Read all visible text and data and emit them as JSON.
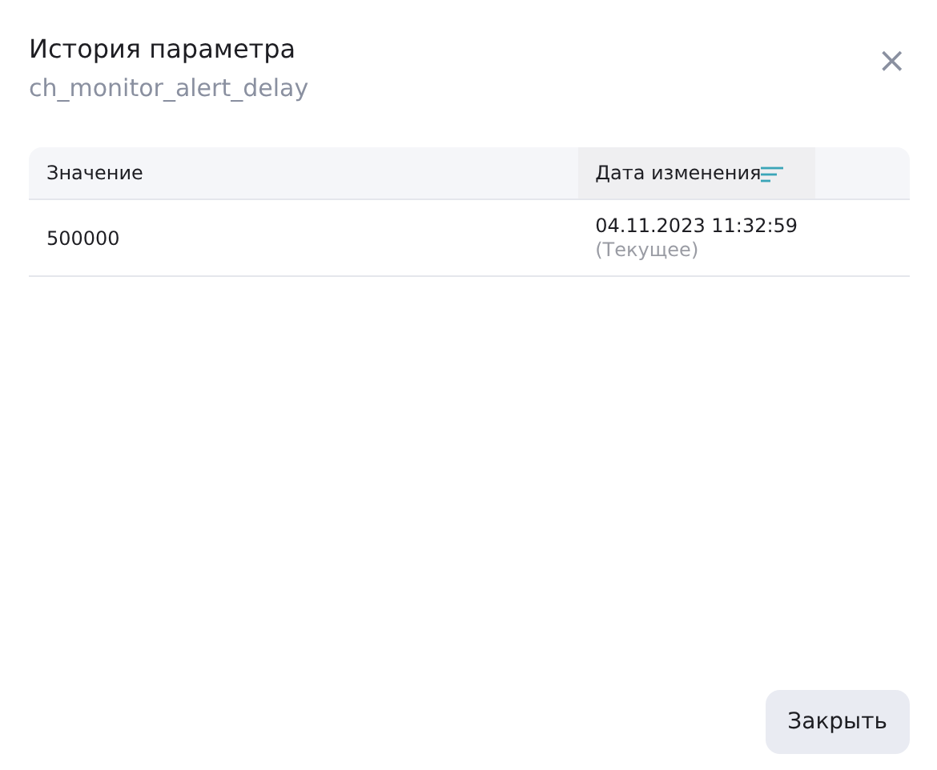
{
  "dialog": {
    "title": "История параметра",
    "subtitle": "ch_monitor_alert_delay",
    "close_icon": "×"
  },
  "table": {
    "columns": [
      {
        "label": "Значение",
        "sorted": false
      },
      {
        "label": "Дата изменения",
        "sorted": true
      }
    ],
    "rows": [
      {
        "value": "500000",
        "date": "04.11.2023 11:32:59",
        "note": "(Текущее)"
      }
    ]
  },
  "buttons": [
    "Закрыть"
  ]
}
